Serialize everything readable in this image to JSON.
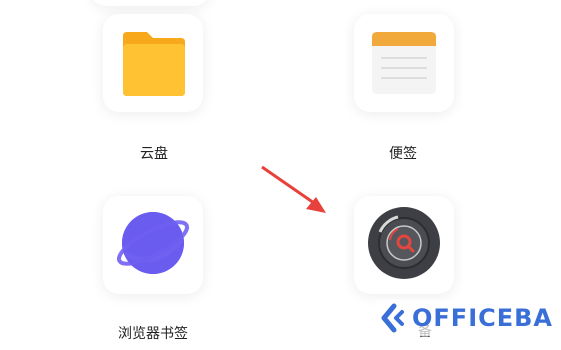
{
  "apps": [
    {
      "label": "云盘",
      "icon": "folder-icon"
    },
    {
      "label": "便签",
      "icon": "notepad-icon"
    },
    {
      "label": "浏览器书签",
      "icon": "planet-icon"
    },
    {
      "label": "备",
      "icon": "camera-lens-icon"
    }
  ],
  "watermark": {
    "text": "OFFICEBA",
    "icon": "officeba-logo-icon",
    "color": "#3a6fd8"
  },
  "colors": {
    "folder": "#ffc233",
    "note_header": "#f2a93b",
    "planet": "#6b5cf0",
    "lens": "#3d3f45",
    "lens_accent": "#e2463e",
    "arrow": "#e8403a"
  }
}
